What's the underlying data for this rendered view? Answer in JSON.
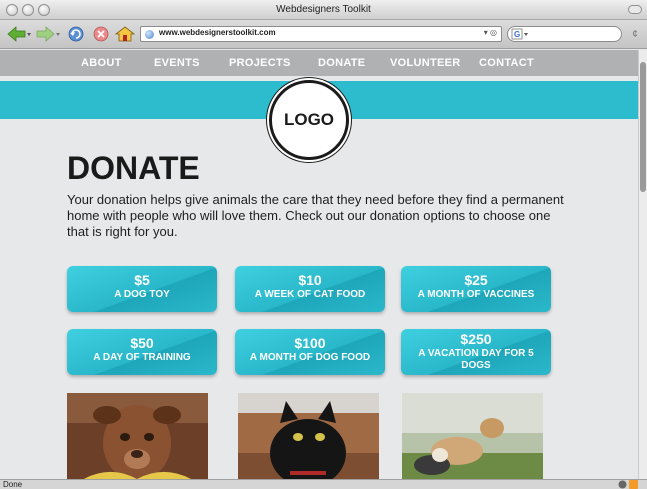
{
  "browser": {
    "window_title": "Webdesigners Toolkit",
    "url": "www.webdesignerstoolkit.com",
    "status": "Done"
  },
  "nav": {
    "items": [
      "ABOUT",
      "EVENTS",
      "PROJECTS",
      "DONATE",
      "VOLUNTEER",
      "CONTACT"
    ]
  },
  "logo": {
    "label": "LOGO"
  },
  "page": {
    "title": "DONATE",
    "intro": "Your donation helps give animals the care that they need before they find a permanent home with people who will love them. Check out our donation options to choose one that is right for you."
  },
  "donations": [
    {
      "amount": "$5",
      "description": "A DOG TOY"
    },
    {
      "amount": "$10",
      "description": "A WEEK OF CAT FOOD"
    },
    {
      "amount": "$25",
      "description": "A MONTH OF VACCINES"
    },
    {
      "amount": "$50",
      "description": "A DAY OF TRAINING"
    },
    {
      "amount": "$100",
      "description": "A MONTH OF DOG FOOD"
    },
    {
      "amount": "$250",
      "description": "A VACATION DAY FOR 5 DOGS"
    }
  ],
  "photos": [
    {
      "subject": "dog-in-yellow-scarf"
    },
    {
      "subject": "black-cat"
    },
    {
      "subject": "two-dogs-in-field"
    }
  ],
  "colors": {
    "accent": "#2cbcce",
    "nav_bg": "#b0b1b3",
    "page_bg": "#e7e8ea",
    "heading": "#1a1a1a"
  }
}
